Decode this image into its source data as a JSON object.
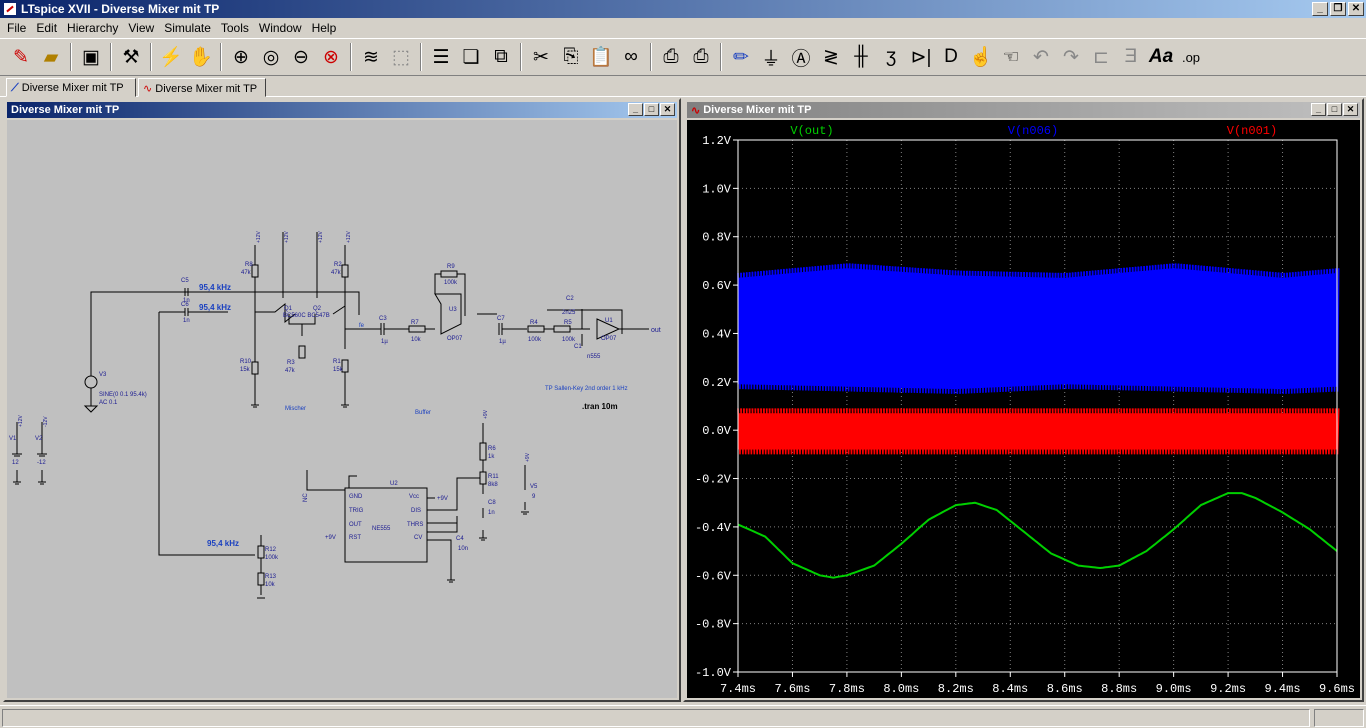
{
  "app": {
    "title": "LTspice XVII - Diverse Mixer mit TP"
  },
  "menu": [
    "File",
    "Edit",
    "Hierarchy",
    "View",
    "Simulate",
    "Tools",
    "Window",
    "Help"
  ],
  "tabs": [
    {
      "label": "Diverse Mixer mit TP",
      "icon": "schematic-icon"
    },
    {
      "label": "Diverse Mixer mit TP",
      "icon": "waveform-icon"
    }
  ],
  "schematic": {
    "title": "Diverse Mixer mit TP",
    "labels": {
      "v1_name": "V1",
      "v1_val": "12",
      "v2_name": "V2",
      "v2_val": "-12",
      "v3_name": "V3",
      "v3_val1": "SINE(0 0.1 95.4k)",
      "v3_val2": "AC 0.1",
      "c5": "C5",
      "c5v": "1n",
      "c6": "C6",
      "c6v": "1n",
      "f1": "95,4 kHz",
      "f2": "95,4 kHz",
      "f3": "95,4 kHz",
      "r8": "R8",
      "r8v": "47k",
      "r2": "R2",
      "r2v": "47k",
      "q1": "Q1",
      "q2": "Q2",
      "qmodel": "BC560C BC547B",
      "r10": "R10",
      "r10v": "15k",
      "r3": "R3",
      "r3v": "47k",
      "r1": "R1",
      "r1v": "15k",
      "mischer": "Mischer",
      "fe": "fe",
      "c3": "C3",
      "c3v": "1µ",
      "r7": "R7",
      "r7v": "10k",
      "r9": "R9",
      "r9v": "100k",
      "u3": "U3",
      "op07a": "OP07",
      "buffer": "Buffer",
      "c7": "C7",
      "c7v": "1µ",
      "r4": "R4",
      "r4v": "100k",
      "r5": "R5",
      "r5v": "100k",
      "c2": "C2",
      "c2v": "2n25",
      "c1": "C1",
      "c1v": "n555",
      "u1": "U1",
      "op07b": "OP07",
      "out": "out",
      "tp": "TP Sallen-Key 2nd order 1 kHz",
      "tran": ".tran 10m",
      "u2": "U2",
      "ne555": "NE555",
      "gnd": "GND",
      "vcc": "Vcc",
      "trig": "TRIG",
      "dis": "DIS",
      "outp": "OUT",
      "thrs": "THRS",
      "rst": "RST",
      "cv": "CV",
      "p9v1": "+9V",
      "p9v2": "+9V",
      "r6": "R6",
      "r6v": "1k",
      "r11": "R11",
      "r11v": "8k8",
      "c8": "C8",
      "c8v": "1n",
      "c4": "C4",
      "c4v": "10n",
      "v5": "V5",
      "v5v": "9",
      "r12": "R12",
      "r12v": "100k",
      "r13": "R13",
      "r13v": "10k",
      "nc": "NC"
    }
  },
  "plot": {
    "title": "Diverse Mixer mit TP",
    "traces": [
      {
        "name": "V(out)",
        "color": "#00d000"
      },
      {
        "name": "V(n006)",
        "color": "#0000ff"
      },
      {
        "name": "V(n001)",
        "color": "#ff0000"
      }
    ],
    "yticks": [
      "1.2V",
      "1.0V",
      "0.8V",
      "0.6V",
      "0.4V",
      "0.2V",
      "0.0V",
      "-0.2V",
      "-0.4V",
      "-0.6V",
      "-0.8V",
      "-1.0V"
    ],
    "xticks": [
      "7.4ms",
      "7.6ms",
      "7.8ms",
      "8.0ms",
      "8.2ms",
      "8.4ms",
      "8.6ms",
      "8.8ms",
      "9.0ms",
      "9.2ms",
      "9.4ms",
      "9.6ms"
    ]
  },
  "chart_data": {
    "type": "line",
    "xlabel": "",
    "ylabel": "",
    "xlim": [
      7.4,
      9.6
    ],
    "ylim": [
      -1.0,
      1.2
    ],
    "x_unit": "ms",
    "y_unit": "V",
    "grid": true,
    "legend": "top",
    "series": [
      {
        "name": "V(out)",
        "color": "#00d000",
        "x": [
          7.4,
          7.5,
          7.6,
          7.7,
          7.75,
          7.8,
          7.9,
          8.0,
          8.1,
          8.2,
          8.27,
          8.35,
          8.45,
          8.55,
          8.65,
          8.73,
          8.8,
          8.9,
          9.0,
          9.1,
          9.2,
          9.25,
          9.3,
          9.4,
          9.5,
          9.6
        ],
        "y": [
          -0.39,
          -0.44,
          -0.55,
          -0.6,
          -0.61,
          -0.6,
          -0.56,
          -0.47,
          -0.37,
          -0.31,
          -0.3,
          -0.33,
          -0.42,
          -0.51,
          -0.56,
          -0.57,
          -0.56,
          -0.5,
          -0.41,
          -0.31,
          -0.26,
          -0.26,
          -0.28,
          -0.34,
          -0.41,
          -0.5
        ]
      },
      {
        "name": "V(n006)",
        "color": "#0000ff",
        "envelope_x": [
          7.4,
          7.8,
          8.2,
          8.6,
          9.0,
          9.4,
          9.6
        ],
        "envelope_max": [
          0.65,
          0.69,
          0.66,
          0.65,
          0.69,
          0.65,
          0.67
        ],
        "envelope_min": [
          0.17,
          0.16,
          0.15,
          0.17,
          0.16,
          0.15,
          0.16
        ]
      },
      {
        "name": "V(n001)",
        "color": "#ff0000",
        "envelope_x": [
          7.4,
          9.6
        ],
        "envelope_max": [
          0.09,
          0.09
        ],
        "envelope_min": [
          -0.1,
          -0.1
        ]
      }
    ]
  }
}
